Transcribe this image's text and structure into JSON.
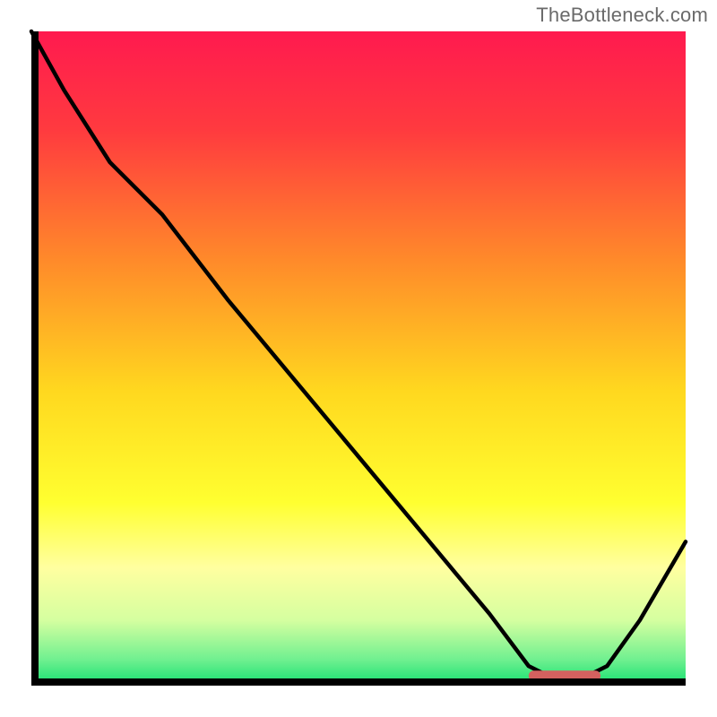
{
  "watermark": "TheBottleneck.com",
  "chart_data": {
    "type": "line",
    "title": "",
    "xlabel": "",
    "ylabel": "",
    "xlim": [
      0,
      100
    ],
    "ylim": [
      0,
      100
    ],
    "grid": false,
    "legend": false,
    "gradient_bands": [
      {
        "stop": 0.0,
        "color": "#ff1a4f"
      },
      {
        "stop": 0.15,
        "color": "#ff3a3f"
      },
      {
        "stop": 0.35,
        "color": "#ff8a2a"
      },
      {
        "stop": 0.55,
        "color": "#ffd81f"
      },
      {
        "stop": 0.72,
        "color": "#ffff30"
      },
      {
        "stop": 0.82,
        "color": "#ffffa0"
      },
      {
        "stop": 0.9,
        "color": "#d5ffa0"
      },
      {
        "stop": 0.96,
        "color": "#70f090"
      },
      {
        "stop": 1.0,
        "color": "#14e070"
      }
    ],
    "series": [
      {
        "name": "bottleneck-curve",
        "color": "#000000",
        "x": [
          0,
          5,
          12,
          20,
          30,
          40,
          50,
          60,
          70,
          76,
          80,
          84,
          88,
          93,
          100
        ],
        "y": [
          100,
          91,
          80,
          72,
          59,
          47,
          35,
          23,
          11,
          3,
          1,
          1,
          3,
          10,
          22
        ]
      }
    ],
    "marker": {
      "name": "optimal-range",
      "color": "#d4615f",
      "x_start": 76,
      "x_end": 87,
      "y": 1.5,
      "thickness_pct": 1.6
    }
  }
}
